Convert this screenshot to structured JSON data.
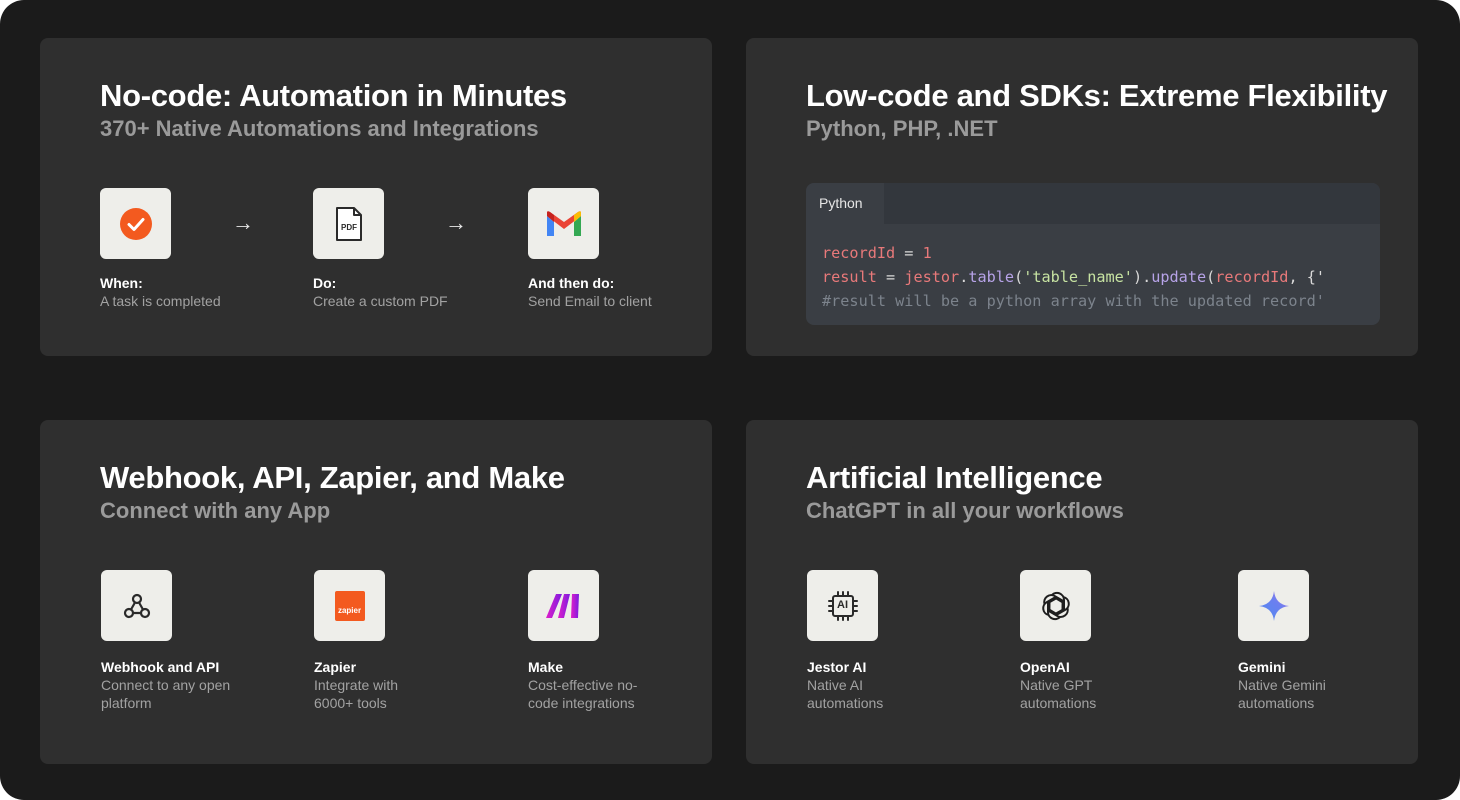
{
  "cards": {
    "nocode": {
      "title": "No-code: Automation in Minutes",
      "subtitle": "370+ Native Automations and Integrations",
      "steps": [
        {
          "label": "When:",
          "desc": "A task is completed",
          "icon": "check-circle-icon"
        },
        {
          "label": "Do:",
          "desc": "Create a custom PDF",
          "icon": "pdf-icon"
        },
        {
          "label": "And then do:",
          "desc": "Send Email to client",
          "icon": "gmail-icon"
        }
      ],
      "arrow": "→"
    },
    "lowcode": {
      "title": "Low-code and SDKs: Extreme Flexibility",
      "subtitle": "Python, PHP, .NET",
      "tab": "Python",
      "code": {
        "l1_var": "recordId",
        "l1_op": " = ",
        "l1_num": "1",
        "l2_var": "result",
        "l2_op": " = ",
        "l2_obj": "jestor",
        "l2_dot1": ".",
        "l2_fn1": "table",
        "l2_p1": "(",
        "l2_str": "'table_name'",
        "l2_p2": ").",
        "l2_fn2": "update",
        "l2_p3": "(",
        "l2_arg": "recordId",
        "l2_rest": ", {'",
        "l3_cmt": "#result will be a python array with the updated record'"
      }
    },
    "integrations": {
      "title": "Webhook, API, Zapier, and Make",
      "subtitle": "Connect with any App",
      "items": [
        {
          "label": "Webhook and API",
          "desc1": "Connect to any open",
          "desc2": "platform",
          "icon": "webhook-icon"
        },
        {
          "label": "Zapier",
          "desc1": "Integrate with",
          "desc2": "6000+ tools",
          "icon": "zapier-icon",
          "logo_text": "zapier"
        },
        {
          "label": "Make",
          "desc1": "Cost-effective no-",
          "desc2": "code integrations",
          "icon": "make-icon"
        }
      ]
    },
    "ai": {
      "title": "Artificial Intelligence",
      "subtitle": "ChatGPT in all your workflows",
      "items": [
        {
          "label": "Jestor AI",
          "desc1": "Native AI",
          "desc2": "automations",
          "icon": "ai-chip-icon",
          "logo_text": "AI"
        },
        {
          "label": "OpenAI",
          "desc1": "Native GPT",
          "desc2": "automations",
          "icon": "openai-icon"
        },
        {
          "label": "Gemini",
          "desc1": "Native Gemini",
          "desc2": "automations",
          "icon": "gemini-icon"
        }
      ]
    }
  },
  "colors": {
    "frame": "#1b1b1b",
    "card": "#2f2f2f",
    "tile": "#eeeeea",
    "accent_orange": "#f35a1f",
    "make_purple": "#a21bd8"
  }
}
